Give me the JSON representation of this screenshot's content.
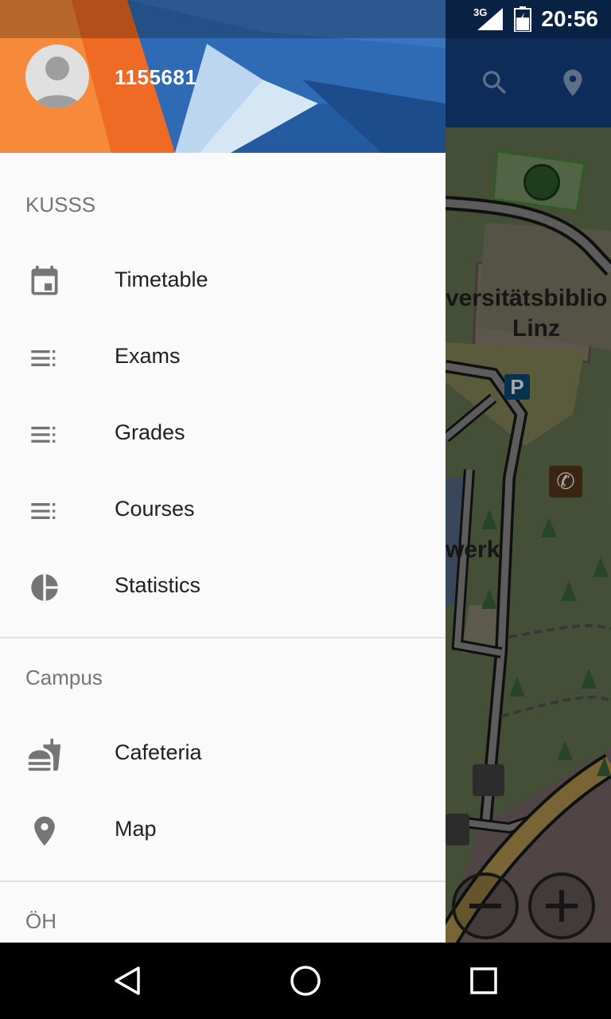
{
  "status": {
    "network": "3G",
    "time": "20:56"
  },
  "toolbar": {
    "search_icon": "search-icon",
    "location_icon": "location-pin-icon"
  },
  "map": {
    "label_library": "versitätsbiblio",
    "label_linz": "Linz",
    "label_werk": "werk",
    "parking_label": "P"
  },
  "drawer": {
    "user_id": "1155681",
    "sections": [
      {
        "title": "KUSSS"
      },
      {
        "title": "Campus"
      },
      {
        "title": "ÖH"
      }
    ],
    "items": [
      {
        "label": "Timetable",
        "icon": "calendar-icon"
      },
      {
        "label": "Exams",
        "icon": "list-icon"
      },
      {
        "label": "Grades",
        "icon": "list-icon"
      },
      {
        "label": "Courses",
        "icon": "list-icon"
      },
      {
        "label": "Statistics",
        "icon": "pie-chart-icon"
      },
      {
        "label": "Cafeteria",
        "icon": "fastfood-icon"
      },
      {
        "label": "Map",
        "icon": "location-pin-icon"
      }
    ]
  },
  "colors": {
    "header_orange": "#f57f2b",
    "header_blue": "#2f6bb5",
    "toolbar": "#0d2c5a",
    "drawer_bg": "#fafafa"
  }
}
